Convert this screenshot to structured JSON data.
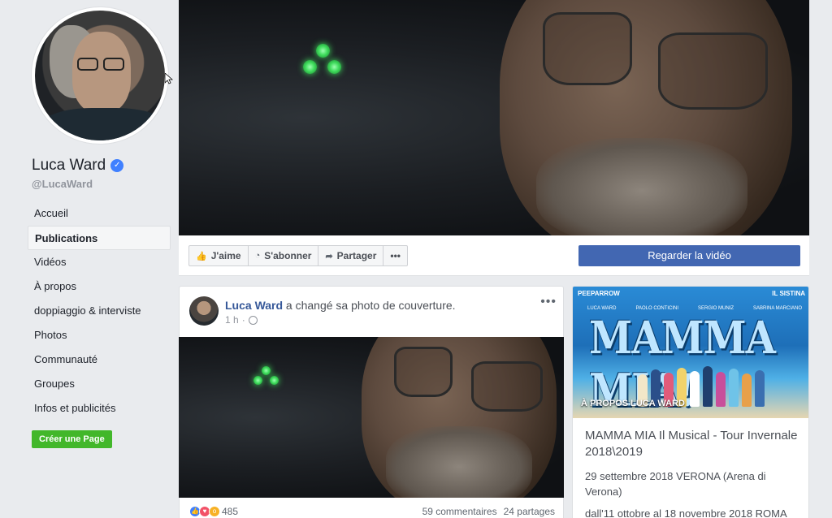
{
  "profile": {
    "name": "Luca Ward",
    "handle": "@LucaWard"
  },
  "nav": {
    "items": [
      {
        "label": "Accueil",
        "active": false
      },
      {
        "label": "Publications",
        "active": true
      },
      {
        "label": "Vidéos",
        "active": false
      },
      {
        "label": "À propos",
        "active": false
      },
      {
        "label": "doppiaggio & interviste",
        "active": false
      },
      {
        "label": "Photos",
        "active": false
      },
      {
        "label": "Communauté",
        "active": false
      },
      {
        "label": "Groupes",
        "active": false
      },
      {
        "label": "Infos et publicités",
        "active": false
      }
    ],
    "create_page": "Créer une Page"
  },
  "actions": {
    "like": "J'aime",
    "follow": "S'abonner",
    "share": "Partager",
    "more": "•••",
    "watch_video": "Regarder la vidéo"
  },
  "post": {
    "author": "Luca Ward",
    "action_text": " a changé sa photo de couverture.",
    "time": "1 h",
    "menu": "•••",
    "reaction_count": "485",
    "comments": "59 commentaires",
    "shares": "24 partages"
  },
  "side_card": {
    "poster_brand_left": "PEEPARROW",
    "poster_brand_right": "IL SISTINA",
    "poster_names": [
      "LUCA WARD",
      "PAOLO CONTICINI",
      "SERGIO MUNIZ",
      "SABRINA MARCIANO"
    ],
    "poster_title": "MAMMA MIA!",
    "poster_label": "À PROPOS LUCA WARD",
    "title": "MAMMA MIA Il Musical - Tour Invernale 2018\\2019",
    "line1": "29 settembre 2018 VERONA (Arena di Verona)",
    "line2": "dall'11 ottobre al 18 novembre 2018 ROMA"
  },
  "colors": {
    "brand_blue": "#4267b2",
    "link_blue": "#365899",
    "create_green": "#42b72a",
    "background": "#e9ebee"
  }
}
